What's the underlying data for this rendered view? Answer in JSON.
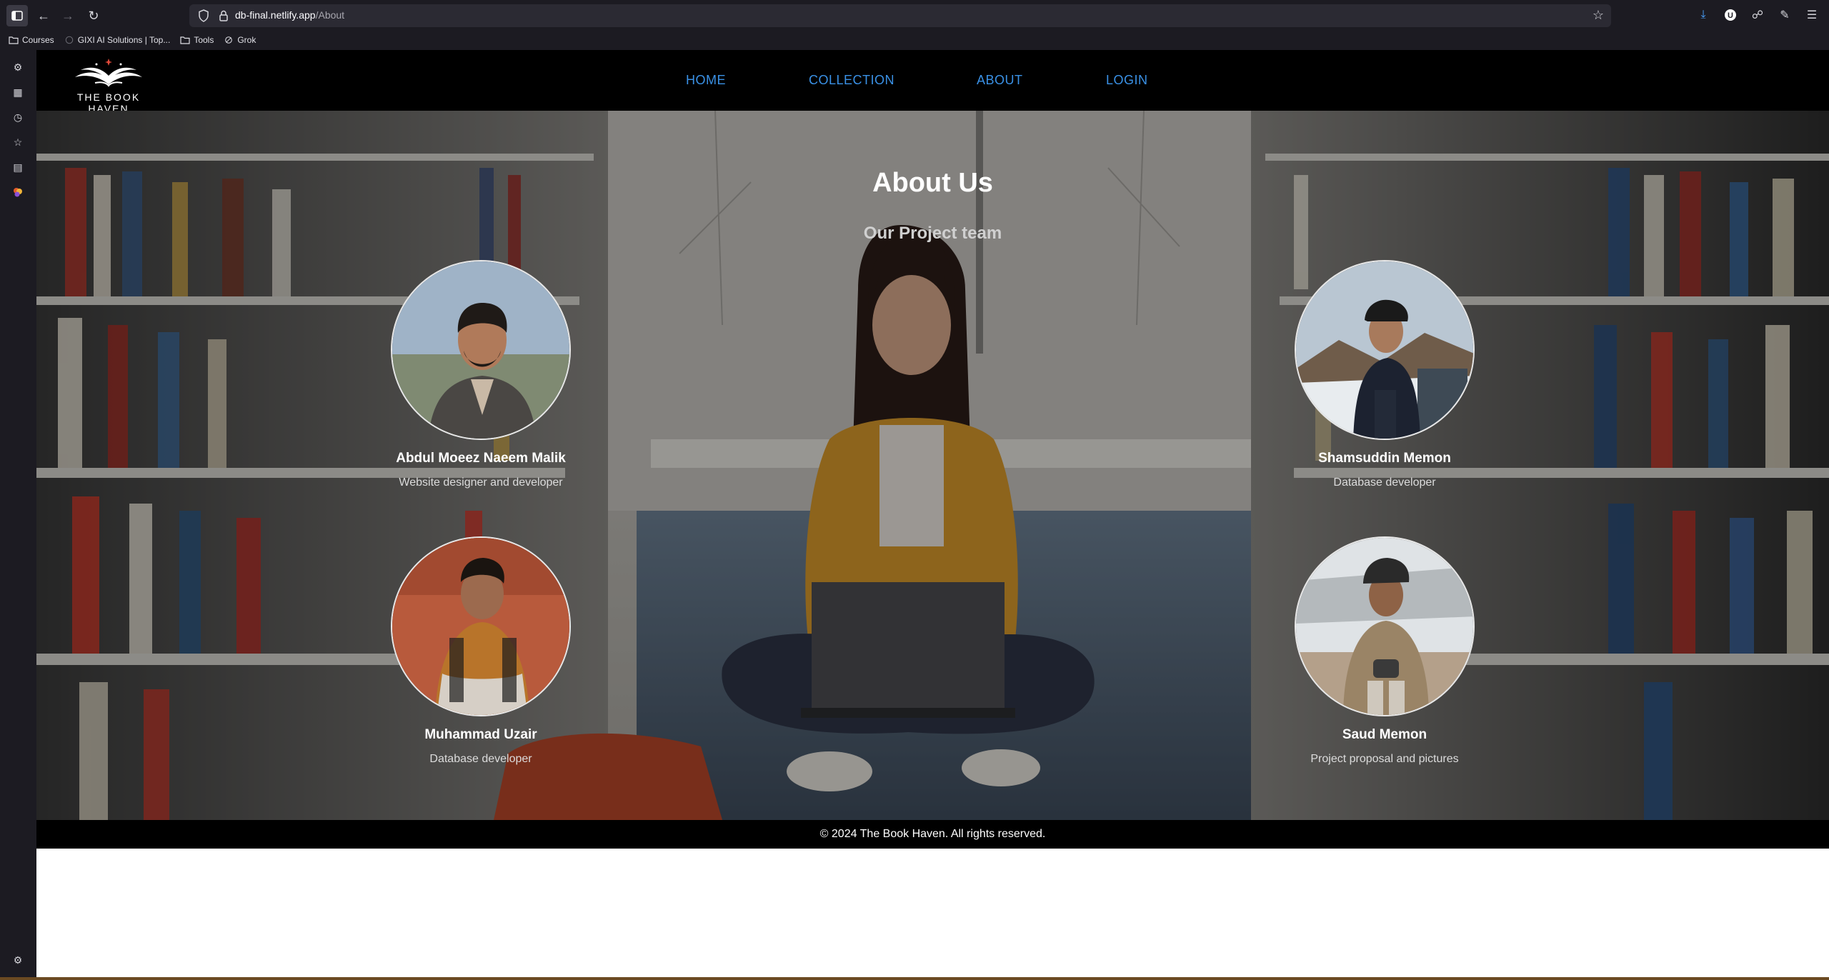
{
  "browser": {
    "url_host": "db-final.netlify.app",
    "url_path": "/About",
    "bookmarks": [
      "Courses",
      "GIXI AI Solutions | Top...",
      "Tools",
      "Grok"
    ]
  },
  "site": {
    "logo_text": "THE BOOK HAVEN",
    "nav": [
      "HOME",
      "COLLECTION",
      "ABOUT",
      "LOGIN"
    ],
    "title": "About Us",
    "subtitle": "Our Project team",
    "members": [
      {
        "name": "Abdul Moeez Naeem Malik",
        "role": "Website designer and developer"
      },
      {
        "name": "Shamsuddin Memon",
        "role": "Database developer"
      },
      {
        "name": "Muhammad Uzair",
        "role": "Database developer"
      },
      {
        "name": "Saud Memon",
        "role": "Project proposal and pictures"
      }
    ],
    "footer": "© 2024 The Book Haven. All rights reserved."
  },
  "colors": {
    "nav_link": "#3a91e6",
    "header_bg": "#000000",
    "chrome_bg": "#1c1b22"
  }
}
